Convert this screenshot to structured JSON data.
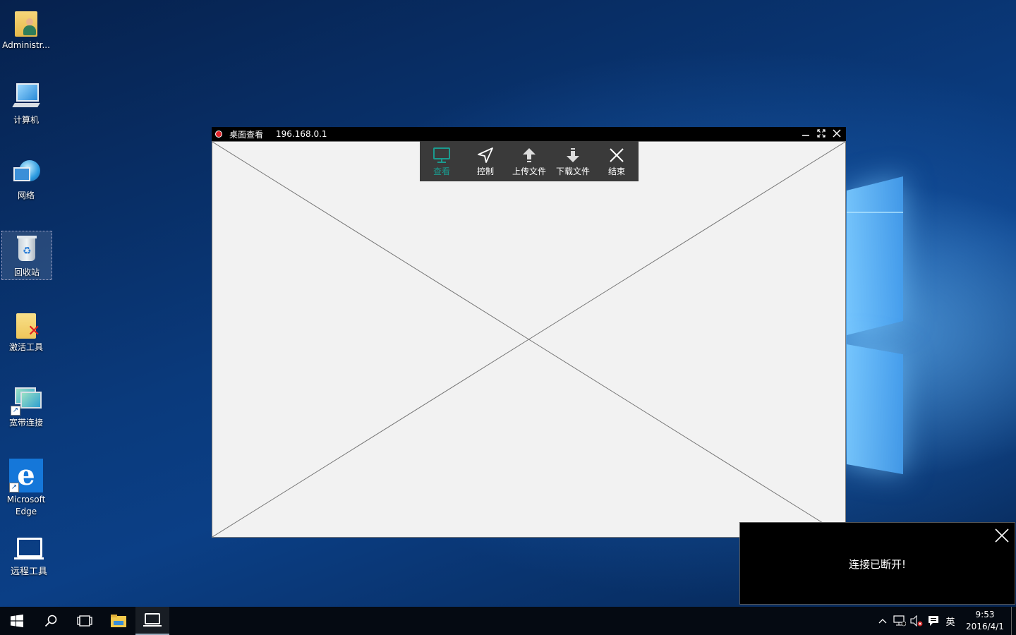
{
  "desktop": {
    "icons": [
      {
        "label": "Administr..."
      },
      {
        "label": "计算机"
      },
      {
        "label": "网络"
      },
      {
        "label": "回收站"
      },
      {
        "label": "激活工具"
      },
      {
        "label": "宽带连接"
      },
      {
        "label": "Microsoft Edge"
      },
      {
        "label": "远程工具"
      }
    ]
  },
  "viewer": {
    "title": "桌面查看",
    "ip": "196.168.0.1",
    "toolbar": [
      {
        "label": "查看",
        "icon": "monitor-icon",
        "active": true
      },
      {
        "label": "控制",
        "icon": "cursor-arrow-icon"
      },
      {
        "label": "上传文件",
        "icon": "upload-arrow-icon"
      },
      {
        "label": "下载文件",
        "icon": "download-arrow-icon"
      },
      {
        "label": "结束",
        "icon": "close-x-icon"
      }
    ],
    "active_color": "#1a9b8f"
  },
  "notification": {
    "message": "连接已断开!"
  },
  "taskbar": {
    "ime": "英",
    "time": "9:53",
    "date": "2016/4/1"
  }
}
